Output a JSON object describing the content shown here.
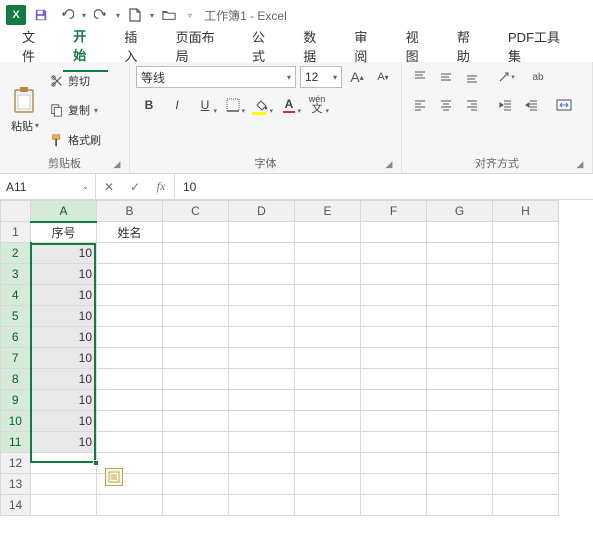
{
  "title": "工作簿1 - Excel",
  "menu": {
    "items": [
      "文件",
      "开始",
      "插入",
      "页面布局",
      "公式",
      "数据",
      "审阅",
      "视图",
      "帮助",
      "PDF工具集"
    ],
    "activeIndex": 1
  },
  "ribbon": {
    "clipboard": {
      "paste": "粘贴",
      "cut": "剪切",
      "copy": "复制",
      "format_painter": "格式刷",
      "group_label": "剪贴板"
    },
    "font": {
      "name": "等线",
      "size": "12",
      "bold": "B",
      "italic": "I",
      "underline": "U",
      "wen": "wén",
      "group_label": "字体"
    },
    "align": {
      "group_label": "对齐方式"
    }
  },
  "formulabar": {
    "namebox": "A11",
    "value": "10"
  },
  "grid": {
    "columns": [
      "A",
      "B",
      "C",
      "D",
      "E",
      "F",
      "G",
      "H"
    ],
    "rows": [
      1,
      2,
      3,
      4,
      5,
      6,
      7,
      8,
      9,
      10,
      11,
      12,
      13,
      14
    ],
    "data": {
      "A1": "序号",
      "B1": "姓名",
      "A2": "10",
      "A3": "10",
      "A4": "10",
      "A5": "10",
      "A6": "10",
      "A7": "10",
      "A8": "10",
      "A9": "10",
      "A10": "10",
      "A11": "10"
    },
    "selected_cols": [
      "A"
    ],
    "selected_rows": [
      2,
      3,
      4,
      5,
      6,
      7,
      8,
      9,
      10,
      11
    ]
  }
}
